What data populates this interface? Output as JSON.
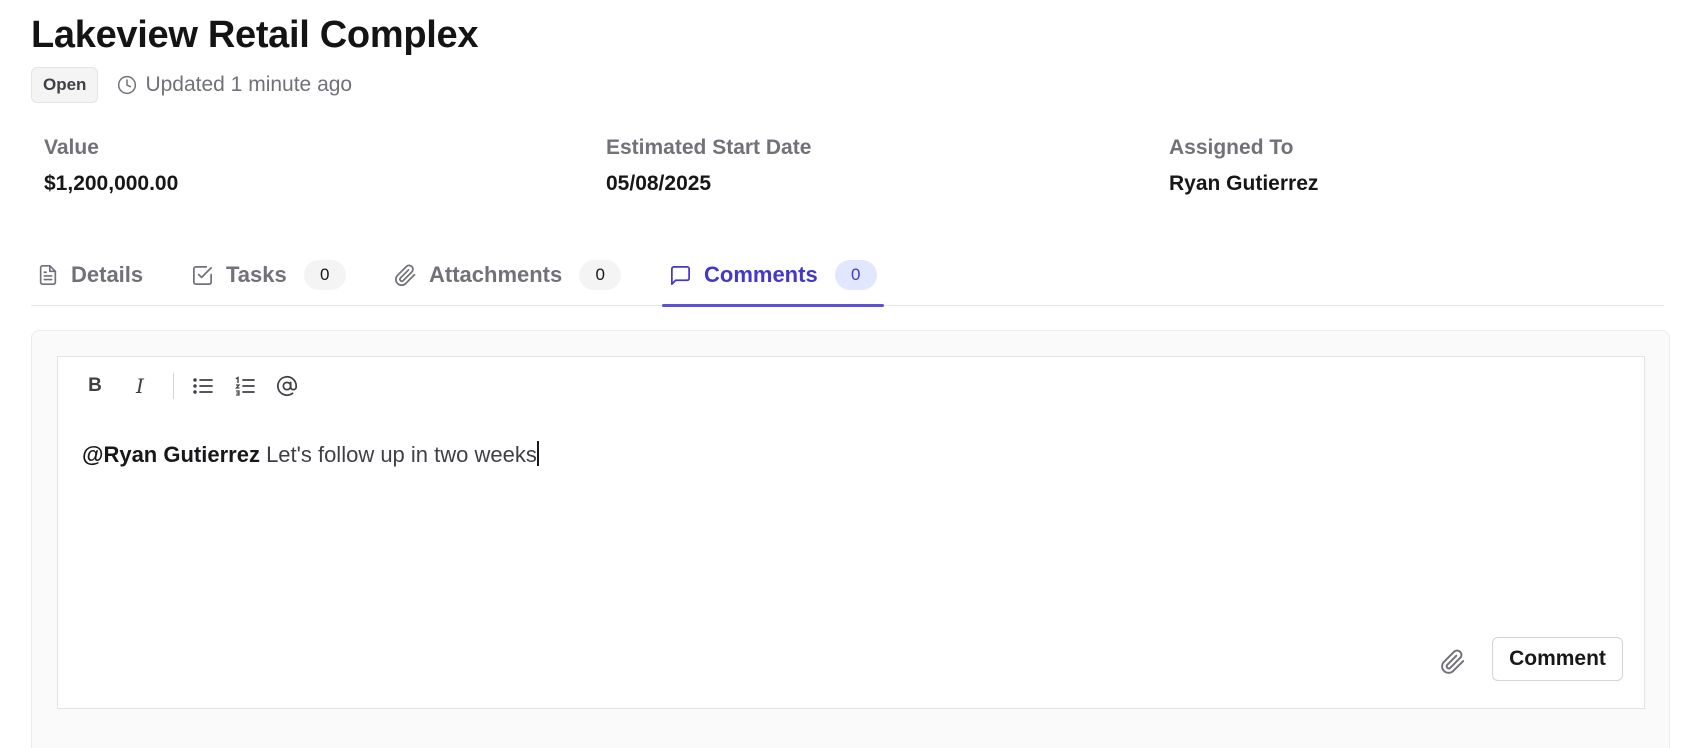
{
  "header": {
    "title": "Lakeview Retail Complex",
    "status": "Open",
    "updated": "Updated 1 minute ago"
  },
  "stats": [
    {
      "label": "Value",
      "value": "$1,200,000.00"
    },
    {
      "label": "Estimated Start Date",
      "value": "05/08/2025"
    },
    {
      "label": "Assigned To",
      "value": "Ryan Gutierrez"
    }
  ],
  "tabs": [
    {
      "label": "Details",
      "icon": "document-icon"
    },
    {
      "label": "Tasks",
      "icon": "checkbox-icon",
      "count": "0"
    },
    {
      "label": "Attachments",
      "icon": "paperclip-icon",
      "count": "0"
    },
    {
      "label": "Comments",
      "icon": "message-icon",
      "count": "0",
      "active": true
    }
  ],
  "editor": {
    "toolbar": {
      "bold": "B",
      "italic": "I"
    },
    "mention": "@Ryan Gutierrez",
    "text": " Let's follow up in two weeks"
  },
  "actions": {
    "comment_label": "Comment"
  },
  "colors": {
    "accent": "#4338ca",
    "accent_bg": "#e0e7ff",
    "tab_underline": "#5b50d6"
  }
}
